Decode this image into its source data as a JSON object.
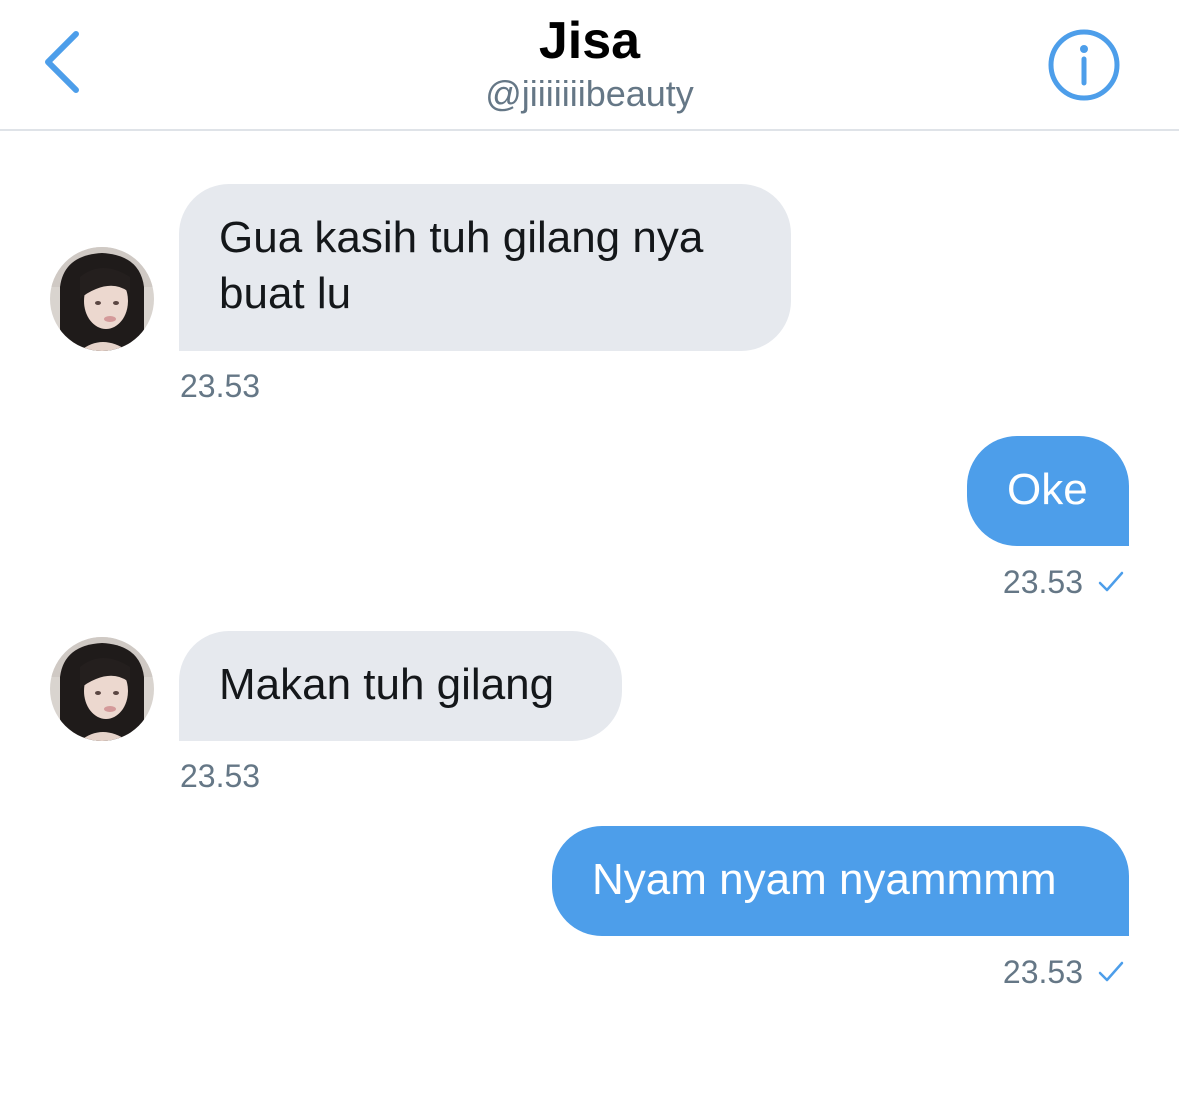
{
  "header": {
    "title": "Jisa",
    "handle": "@jiiiiiiibeauty",
    "back_icon": "chevron-left-icon",
    "info_icon": "info-icon"
  },
  "colors": {
    "accent": "#4d9eea",
    "incoming_bubble": "#e6e9ee",
    "meta_text": "#657786",
    "divider": "#dfe3e8"
  },
  "messages": [
    {
      "direction": "incoming",
      "text": "Gua kasih tuh gilang nya buat lu",
      "time": "23.53"
    },
    {
      "direction": "outgoing",
      "text": "Oke",
      "time": "23.53",
      "status_icon": "checkmark-icon"
    },
    {
      "direction": "incoming",
      "text": "Makan tuh gilang",
      "time": "23.53"
    },
    {
      "direction": "outgoing",
      "text": "Nyam nyam nyammmm",
      "time": "23.53",
      "status_icon": "checkmark-icon"
    }
  ]
}
